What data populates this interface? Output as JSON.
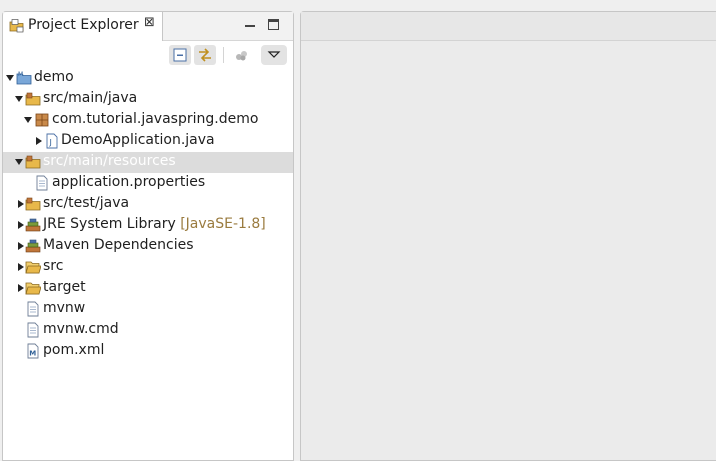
{
  "view": {
    "title": "Project Explorer",
    "close_glyph": "⊠"
  },
  "toolbar": {
    "collapse_all": "collapse-all-icon",
    "link_with_editor": "link-with-editor-icon",
    "filters": "filters-icon",
    "view_menu": "view-menu-icon"
  },
  "tree": [
    {
      "label": "demo",
      "icon": "maven-project-icon",
      "expanded": true
    },
    {
      "label": "src/main/java",
      "icon": "source-folder-icon",
      "expanded": true
    },
    {
      "label": "com.tutorial.javaspring.demo",
      "icon": "package-icon",
      "expanded": true
    },
    {
      "label": "DemoApplication.java",
      "icon": "java-file-icon",
      "expanded": false
    },
    {
      "label": "src/main/resources",
      "icon": "source-folder-icon",
      "expanded": true,
      "selected": true
    },
    {
      "label": "application.properties",
      "icon": "text-file-icon"
    },
    {
      "label": "src/test/java",
      "icon": "source-folder-icon",
      "expanded": false
    },
    {
      "label": "JRE System Library",
      "decoration": "[JavaSE-1.8]",
      "icon": "library-icon",
      "expanded": false
    },
    {
      "label": "Maven Dependencies",
      "icon": "library-icon",
      "expanded": false
    },
    {
      "label": "src",
      "icon": "folder-icon",
      "expanded": false
    },
    {
      "label": "target",
      "icon": "folder-icon",
      "expanded": false
    },
    {
      "label": "mvnw",
      "icon": "text-file-icon"
    },
    {
      "label": "mvnw.cmd",
      "icon": "text-file-icon"
    },
    {
      "label": "pom.xml",
      "icon": "maven-pom-icon"
    }
  ],
  "colors": {
    "selection": "#dcdcdc",
    "decoration": "#9a7b3f",
    "folder": "#e8b84a"
  }
}
